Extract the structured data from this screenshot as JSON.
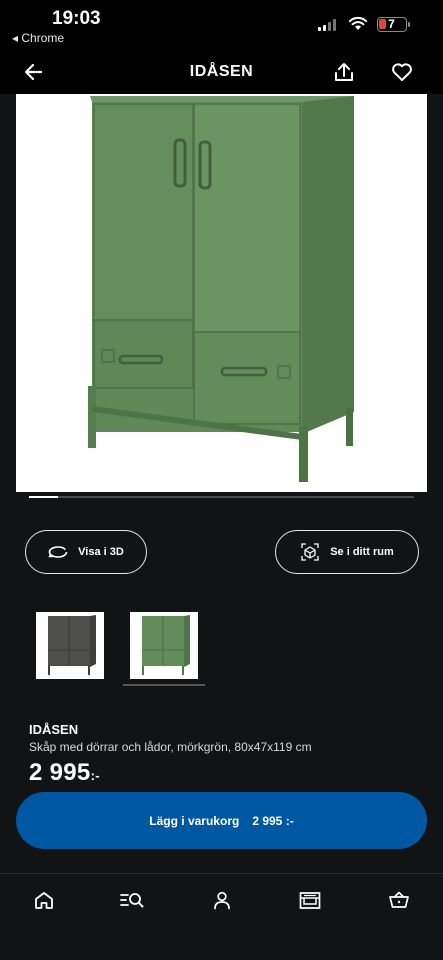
{
  "status_bar": {
    "time": "19:03",
    "back_app": "◂ Chrome",
    "battery": "7",
    "colors": {
      "battery_low": "#e0463b"
    }
  },
  "header": {
    "title": "IDÅSEN",
    "icons": [
      "back-arrow-icon",
      "share-icon",
      "heart-icon"
    ]
  },
  "gallery": {
    "scroll_progress": 0.075
  },
  "actions": {
    "view_3d": "Visa i 3D",
    "view_room": "Se i ditt rum"
  },
  "variants": [
    {
      "color": "#4b4b48",
      "selected": false
    },
    {
      "color": "#5e8a56",
      "selected": true
    }
  ],
  "product": {
    "name": "IDÅSEN",
    "description": "Skåp med dörrar och lådor, mörkgrön, 80x47x119 cm",
    "price": "2 995",
    "price_suffix": ":-"
  },
  "cart": {
    "label": "Lägg i varukorg",
    "price": "2 995 :-",
    "color": "#0058a3"
  },
  "bottom_nav": {
    "items": [
      "home-icon",
      "search-icon",
      "profile-icon",
      "store-icon",
      "cart-icon"
    ]
  }
}
